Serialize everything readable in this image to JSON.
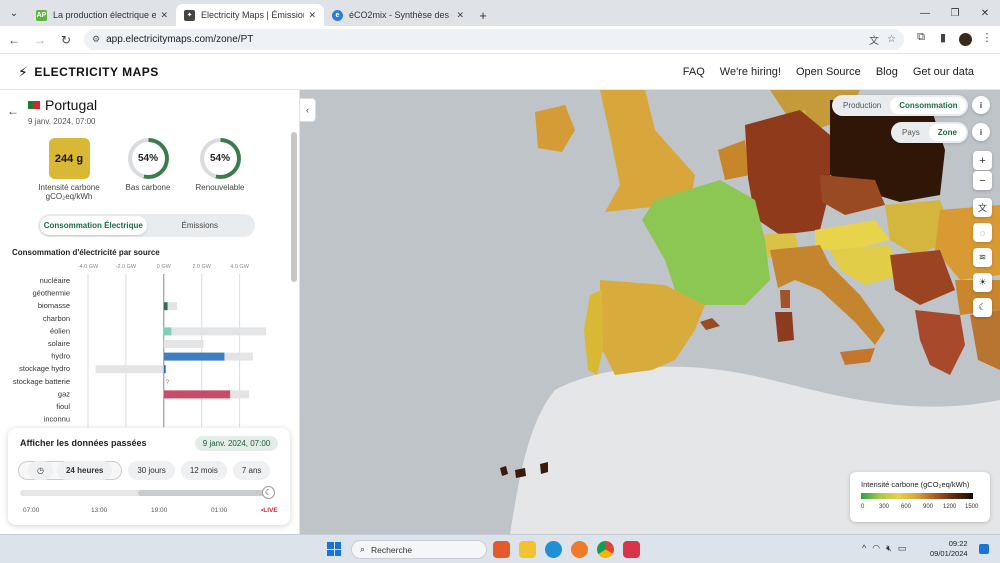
{
  "browser": {
    "tabs": [
      {
        "title": "La production électrique en Fra",
        "favicon": "AP",
        "favicon_color": "#5fb33a",
        "active": false
      },
      {
        "title": "Electricity Maps | Émissions CO",
        "favicon": "✦",
        "favicon_color": "#444444",
        "active": true
      },
      {
        "title": "éCO2mix - Synthèse des donné",
        "favicon": "e",
        "favicon_color": "#2a7fd4",
        "active": false
      }
    ],
    "url": "app.electricitymaps.com/zone/PT"
  },
  "header": {
    "logo_text": "ELECTRICITY MAPS",
    "nav": [
      "FAQ",
      "We're hiring!",
      "Open Source",
      "Blog",
      "Get our data"
    ]
  },
  "zone": {
    "name": "Portugal",
    "datetime": "9 janv. 2024, 07:00",
    "carbon_intensity": "244 g",
    "carbon_intensity_label_1": "Intensité carbone",
    "carbon_intensity_label_2": "gCO₂eq/kWh",
    "low_carbon_pct": 54,
    "low_carbon_value": "54%",
    "low_carbon_label": "Bas carbone",
    "renewable_pct": 54,
    "renewable_value": "54%",
    "renewable_label": "Renouvelable",
    "toggle": [
      "Consommation Électrique",
      "Émissions"
    ],
    "section_title": "Consommation d'électricité par source"
  },
  "chart_data": {
    "type": "bar",
    "orientation": "horizontal",
    "categories": [
      "nucléaire",
      "géothermie",
      "biomasse",
      "charbon",
      "éolien",
      "solaire",
      "hydro",
      "stockage hydro",
      "stockage batterie",
      "gaz",
      "fioul",
      "inconnu"
    ],
    "series": [
      {
        "values": [
          0,
          0,
          0.2,
          0,
          0.4,
          0,
          3.2,
          0.1,
          0,
          3.5,
          0,
          0
        ]
      },
      {
        "values": [
          0,
          0,
          0.7,
          0,
          5.4,
          2.1,
          4.7,
          -3.6,
          0,
          4.5,
          0,
          0
        ]
      }
    ],
    "tick_labels": [
      "-4.0 GW",
      "-2.0 GW",
      "0 GW",
      "2.0 GW",
      "4.0 GW"
    ],
    "xlim": [
      -4.0,
      5.5
    ],
    "colors": {
      "biomasse": "#2f6f56",
      "éolien": "#7fd0b8",
      "hydro": "#3f7ec1",
      "stockage hydro": "#2f62b8",
      "gaz": "#c94a6a",
      "capacity": "#e3e4e5"
    },
    "annotations": [
      {
        "category": "stockage batterie",
        "text": "?"
      }
    ]
  },
  "time_controller": {
    "title": "Afficher les données passées",
    "date": "9 janv. 2024, 07:00",
    "ranges": [
      "24 heures",
      "30 jours",
      "12 mois",
      "7 ans"
    ],
    "ticks": [
      "07:00",
      "13:00",
      "19:00",
      "01:00",
      "LIVE"
    ]
  },
  "map": {
    "toggle_mode": [
      "Production",
      "Consommation"
    ],
    "toggle_level": [
      "Pays",
      "Zone"
    ],
    "legend_title": "Intensité carbone (gCO₂eq/kWh)",
    "legend_ticks": [
      "0",
      "300",
      "600",
      "900",
      "1200",
      "1500"
    ]
  },
  "taskbar": {
    "search_placeholder": "Recherche",
    "time": "09:22",
    "date": "09/01/2024"
  }
}
